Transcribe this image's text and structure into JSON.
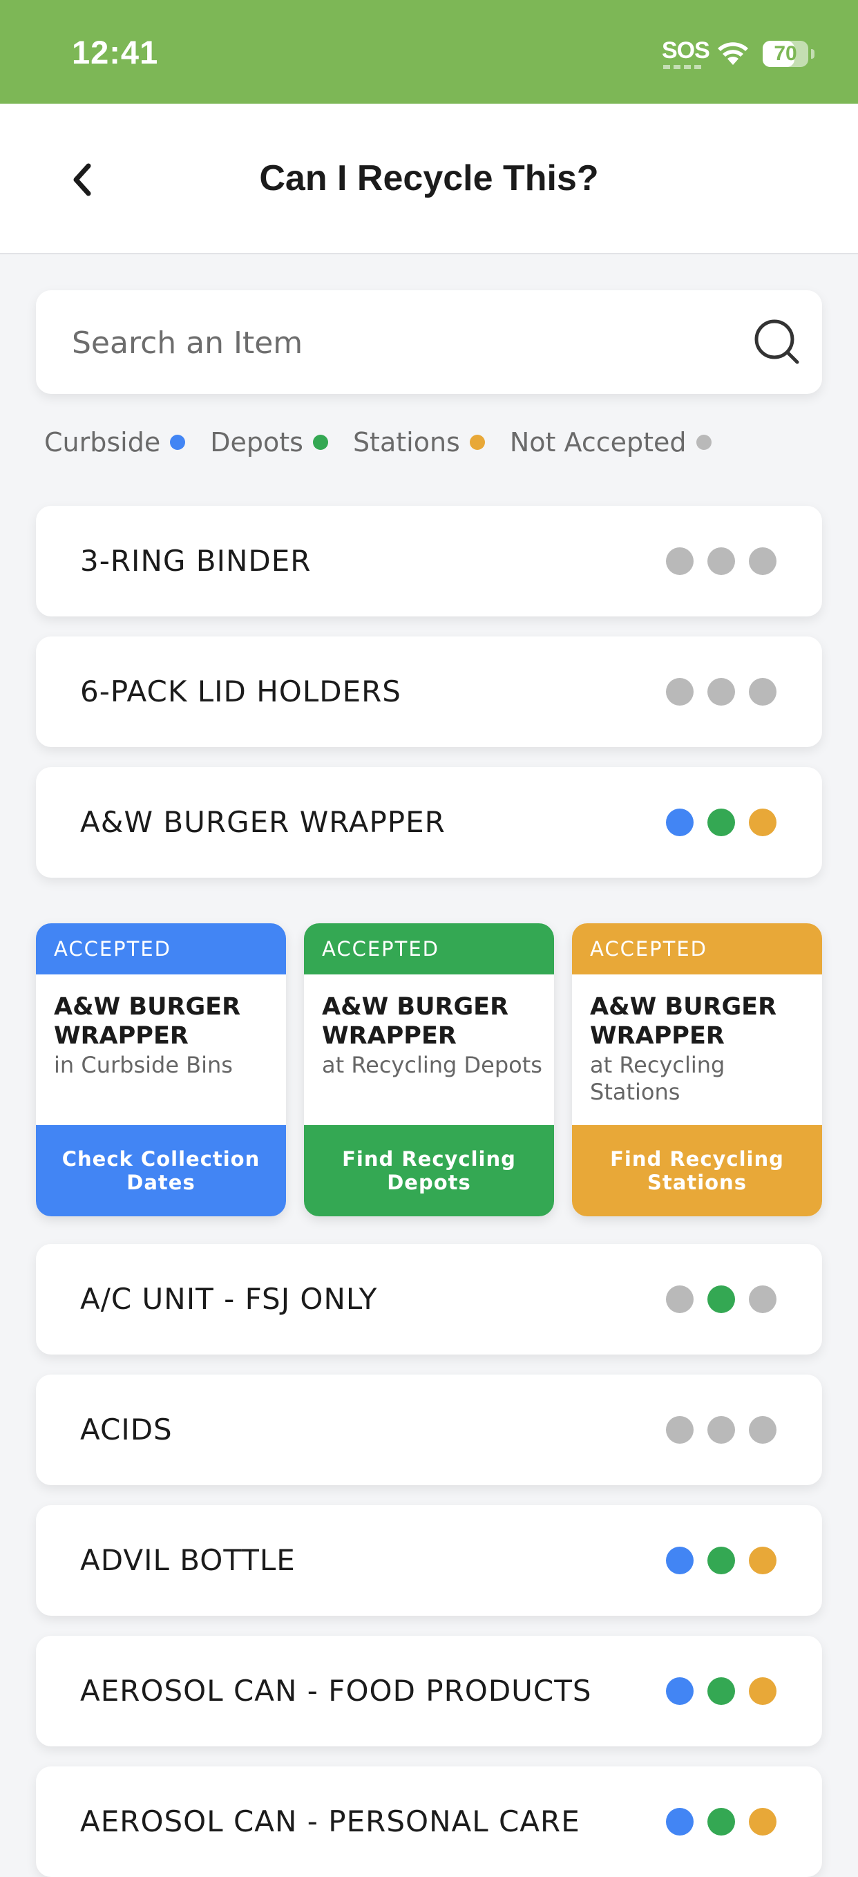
{
  "status_bar": {
    "time": "12:41",
    "sos": "SOS",
    "battery": 70,
    "battery_label": "70"
  },
  "header": {
    "title": "Can I Recycle This?",
    "back_icon": "chevron-left-icon"
  },
  "search": {
    "placeholder": "Search an Item",
    "value": "",
    "icon": "search-icon"
  },
  "colors": {
    "curbside": "#4285f4",
    "depots": "#34a853",
    "stations": "#e8a838",
    "not_accepted": "#b9b9b9",
    "status_bar": "#7db756"
  },
  "legend": [
    {
      "label": "Curbside",
      "color": "#4285f4"
    },
    {
      "label": "Depots",
      "color": "#34a853"
    },
    {
      "label": "Stations",
      "color": "#e8a838"
    },
    {
      "label": "Not Accepted",
      "color": "#b9b9b9"
    }
  ],
  "items": [
    {
      "name": "3-RING BINDER",
      "curbside": false,
      "depots": false,
      "stations": false
    },
    {
      "name": "6-PACK LID HOLDERS",
      "curbside": false,
      "depots": false,
      "stations": false
    },
    {
      "name": "A&W BURGER WRAPPER",
      "curbside": true,
      "depots": true,
      "stations": true
    },
    {
      "name": "A/C UNIT - FSJ ONLY",
      "curbside": false,
      "depots": true,
      "stations": false
    },
    {
      "name": "ACIDS",
      "curbside": false,
      "depots": false,
      "stations": false
    },
    {
      "name": "ADVIL BOTTLE",
      "curbside": true,
      "depots": true,
      "stations": true
    },
    {
      "name": "AEROSOL CAN - FOOD PRODUCTS",
      "curbside": true,
      "depots": true,
      "stations": true
    },
    {
      "name": "AEROSOL CAN - PERSONAL CARE",
      "curbside": true,
      "depots": true,
      "stations": true
    }
  ],
  "expanded_cards": [
    {
      "status": "ACCEPTED",
      "name": "A&W BURGER WRAPPER",
      "where": "in Curbside Bins",
      "button": "Check Collection Dates",
      "color": "#4285f4"
    },
    {
      "status": "ACCEPTED",
      "name": "A&W BURGER WRAPPER",
      "where": "at Recycling Depots",
      "button": "Find Recycling Depots",
      "color": "#34a853"
    },
    {
      "status": "ACCEPTED",
      "name": "A&W BURGER WRAPPER",
      "where": "at Recycling Stations",
      "button": "Find Recycling Stations",
      "color": "#e8a838"
    }
  ]
}
